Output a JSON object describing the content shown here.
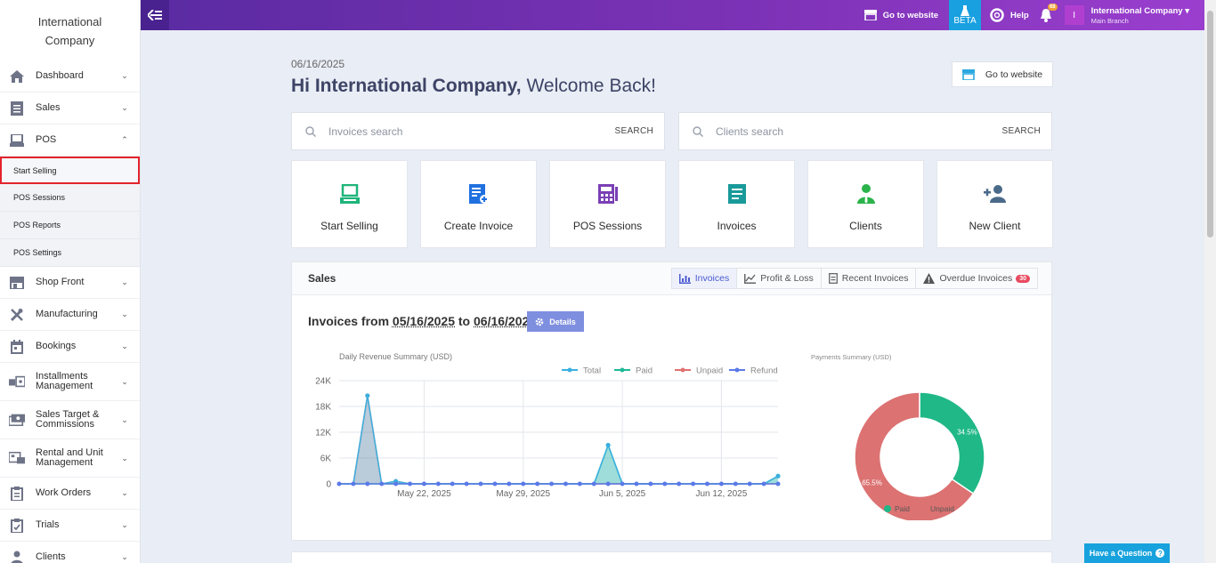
{
  "sidebar": {
    "brand": "International Company",
    "items": [
      {
        "label": "Dashboard",
        "icon": "home-icon"
      },
      {
        "label": "Sales",
        "icon": "invoice-icon"
      },
      {
        "label": "POS",
        "icon": "pos-terminal-icon"
      },
      {
        "label": "Shop Front",
        "icon": "storefront-icon"
      },
      {
        "label": "Manufacturing",
        "icon": "tools-icon"
      },
      {
        "label": "Bookings",
        "icon": "calendar-icon"
      },
      {
        "label": "Installments Management",
        "icon": "installments-icon"
      },
      {
        "label": "Sales Target & Commissions",
        "icon": "cash-icon"
      },
      {
        "label": "Rental and Unit Management",
        "icon": "rental-icon"
      },
      {
        "label": "Work Orders",
        "icon": "clipboard-icon"
      },
      {
        "label": "Trials",
        "icon": "checklist-icon"
      },
      {
        "label": "Clients",
        "icon": "client-icon"
      }
    ],
    "pos_sub": [
      "Start Selling",
      "POS Sessions",
      "POS Reports",
      "POS Settings"
    ]
  },
  "topbar": {
    "go_to_website": "Go to website",
    "beta": "BETA",
    "help": "Help",
    "notifications": "68",
    "avatar_letter": "I",
    "account_name": "International Company",
    "branch": "Main Branch"
  },
  "main": {
    "date": "06/16/2025",
    "greeting_name": "Hi International Company,",
    "greeting_rest": " Welcome Back!",
    "go_to_website": "Go to website",
    "invoices_search_placeholder": "Invoices search",
    "clients_search_placeholder": "Clients search",
    "search_label": "SEARCH",
    "tiles": [
      {
        "label": "Start Selling",
        "icon": "pos-terminal-icon",
        "color": "#1fb47a"
      },
      {
        "label": "Create Invoice",
        "icon": "create-invoice-icon",
        "color": "#2070e0"
      },
      {
        "label": "POS Sessions",
        "icon": "calculator-icon",
        "color": "#7b3fb5"
      },
      {
        "label": "Invoices",
        "icon": "document-icon",
        "color": "#1a9a9a"
      },
      {
        "label": "Clients",
        "icon": "client-icon",
        "color": "#2ab34a"
      },
      {
        "label": "New Client",
        "icon": "add-user-icon",
        "color": "#4a6a8a"
      }
    ]
  },
  "sales_panel": {
    "title": "Sales",
    "tabs": [
      "Invoices",
      "Profit & Loss",
      "Recent Invoices",
      "Overdue Invoices"
    ],
    "overdue_count": "30",
    "invoices_from": "Invoices from",
    "date_from": "05/16/2025",
    "to": "to",
    "date_to": "06/16/2025",
    "details": "Details"
  },
  "help_button": "Have a Question",
  "chart_data": [
    {
      "type": "line",
      "title": "Daily Revenue Summary (USD)",
      "x_tick_labels": [
        "May 22, 2025",
        "May 29, 2025",
        "Jun 5, 2025",
        "Jun 12, 2025"
      ],
      "ylim": [
        0,
        24000
      ],
      "y_tick_labels": [
        "24K",
        "18K",
        "12K",
        "6K",
        "0"
      ],
      "y_ticks": [
        24000,
        18000,
        12000,
        6000,
        0
      ],
      "grid": true,
      "legend_position": "top-right",
      "x_days": [
        "05/16",
        "05/17",
        "05/18",
        "05/19",
        "05/20",
        "05/21",
        "05/22",
        "05/23",
        "05/24",
        "05/25",
        "05/26",
        "05/27",
        "05/28",
        "05/29",
        "05/30",
        "05/31",
        "06/01",
        "06/02",
        "06/03",
        "06/04",
        "06/05",
        "06/06",
        "06/07",
        "06/08",
        "06/09",
        "06/10",
        "06/11",
        "06/12",
        "06/13",
        "06/14",
        "06/15",
        "06/16"
      ],
      "series": [
        {
          "name": "Total",
          "color": "#3ab0e0",
          "values": [
            0,
            0,
            20500,
            0,
            600,
            0,
            0,
            0,
            0,
            0,
            0,
            0,
            0,
            0,
            0,
            0,
            0,
            0,
            0,
            9000,
            0,
            0,
            0,
            0,
            0,
            0,
            0,
            0,
            0,
            0,
            0,
            1800
          ]
        },
        {
          "name": "Paid",
          "color": "#1fb896",
          "values": [
            0,
            0,
            0,
            0,
            0,
            0,
            0,
            0,
            0,
            0,
            0,
            0,
            0,
            0,
            0,
            0,
            0,
            0,
            0,
            9000,
            0,
            0,
            0,
            0,
            0,
            0,
            0,
            0,
            0,
            0,
            0,
            1800
          ]
        },
        {
          "name": "Unpaid",
          "color": "#e07070",
          "values": [
            0,
            0,
            20500,
            0,
            600,
            0,
            0,
            0,
            0,
            0,
            0,
            0,
            0,
            0,
            0,
            0,
            0,
            0,
            0,
            0,
            0,
            0,
            0,
            0,
            0,
            0,
            0,
            0,
            0,
            0,
            0,
            0
          ]
        },
        {
          "name": "Refund",
          "color": "#5a7ae8",
          "values": [
            0,
            0,
            0,
            0,
            0,
            0,
            0,
            0,
            0,
            0,
            0,
            0,
            0,
            0,
            0,
            0,
            0,
            0,
            0,
            0,
            0,
            0,
            0,
            0,
            0,
            0,
            0,
            0,
            0,
            0,
            0,
            0
          ]
        }
      ]
    },
    {
      "type": "pie",
      "title": "Payments Summary (USD)",
      "legend_position": "bottom",
      "slices": [
        {
          "name": "Paid",
          "value": 34.5,
          "label": "34.5%",
          "color": "#1fb886"
        },
        {
          "name": "Unpaid",
          "value": 65.5,
          "label": "65.5%",
          "color": "#dc7272"
        }
      ]
    }
  ]
}
